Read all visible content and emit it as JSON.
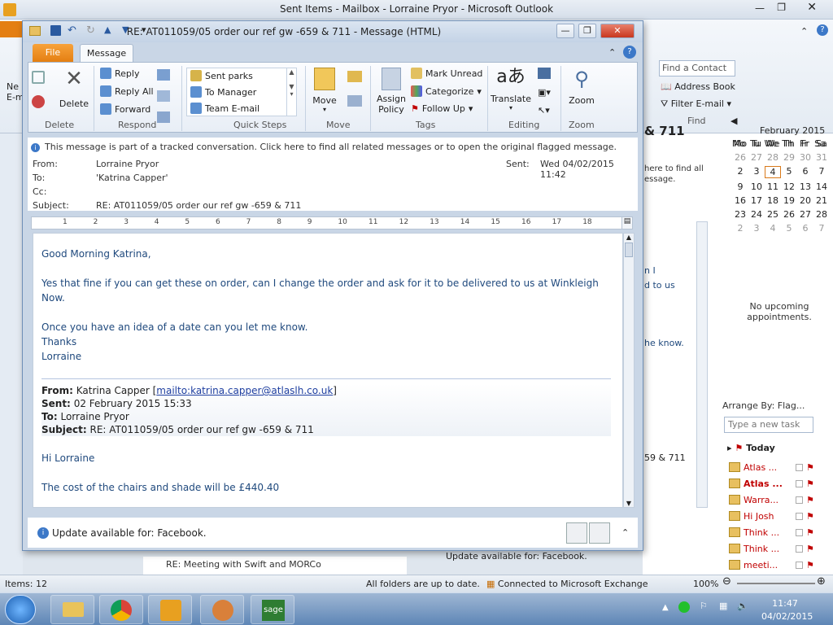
{
  "background": {
    "title": "Sent Items - Mailbox - Lorraine Pryor - Microsoft Outlook",
    "find_contact_placeholder": "Find a Contact",
    "address_book": "Address Book",
    "filter_email": "Filter E-mail",
    "find_group": "Find",
    "calendar": {
      "month": "February 2015",
      "weekdays": [
        "Mo",
        "Tu",
        "We",
        "Th",
        "Fr",
        "Sa"
      ],
      "rows": [
        [
          "26",
          "27",
          "28",
          "29",
          "30",
          "31"
        ],
        [
          "2",
          "3",
          "4",
          "5",
          "6",
          "7"
        ],
        [
          "9",
          "10",
          "11",
          "12",
          "13",
          "14"
        ],
        [
          "16",
          "17",
          "18",
          "19",
          "20",
          "21"
        ],
        [
          "23",
          "24",
          "25",
          "26",
          "27",
          "28"
        ],
        [
          "2",
          "3",
          "4",
          "5",
          "6",
          "7"
        ]
      ]
    },
    "no_appointments": "No upcoming appointments.",
    "arrange_by": "Arrange By: Flag...",
    "new_task_placeholder": "Type a new task",
    "today": "Today",
    "tasks": [
      "Atlas ...",
      "Atlas ...",
      "Warra...",
      "Hi Josh",
      "Think ...",
      "Think ...",
      "meeti..."
    ],
    "reading_snippets": [
      "& 711",
      "here to find all",
      "essage.",
      "n I",
      "d to us",
      "he know.",
      "59 & 711"
    ],
    "list_item_subject": "RE: Meeting with Swift and MORCo",
    "reading_update": "Update available for: Facebook.",
    "status": {
      "items": "Items: 12",
      "folders": "All folders are up to date.",
      "exchange": "Connected to Microsoft Exchange",
      "zoom": "100%"
    },
    "clock": {
      "time": "11:47",
      "date": "04/02/2015"
    },
    "left_labels": [
      "Ne",
      "E-m"
    ]
  },
  "window": {
    "title": "RE: AT011059/05 order our ref  gw -659 & 711  -  Message (HTML)",
    "tabs": {
      "file": "File",
      "message": "Message"
    },
    "ribbon": {
      "delete_label": "Delete",
      "reply": "Reply",
      "reply_all": "Reply All",
      "forward": "Forward",
      "quick_steps": [
        "Sent parks",
        "To Manager",
        "Team E-mail"
      ],
      "move": "Move",
      "assign_policy": "Assign Policy",
      "mark_unread": "Mark Unread",
      "categorize": "Categorize",
      "follow_up": "Follow Up",
      "translate": "Translate",
      "zoom": "Zoom",
      "groups": [
        "Delete",
        "Respond",
        "Quick Steps",
        "Move",
        "Tags",
        "Editing",
        "Zoom"
      ]
    },
    "info": "This message is part of a tracked conversation. Click here to find all related messages or to open the original flagged message.",
    "header": {
      "from_label": "From:",
      "from": "Lorraine Pryor",
      "to_label": "To:",
      "to": "'Katrina Capper'",
      "cc_label": "Cc:",
      "subject_label": "Subject:",
      "subject": "RE: AT011059/05 order our ref  gw -659 & 711",
      "sent_label": "Sent:",
      "sent": "Wed 04/02/2015 11:42"
    },
    "ruler_numbers": [
      "1",
      "2",
      "3",
      "4",
      "5",
      "6",
      "7",
      "8",
      "9",
      "10",
      "11",
      "12",
      "13",
      "14",
      "15",
      "16",
      "17",
      "18"
    ],
    "body": {
      "greeting": "Good Morning Katrina,",
      "para1": "Yes that fine if you can get these on order, can I change the order  and ask for it to be delivered  to us at Winkleigh Now.",
      "para2": "Once you have an idea of a date can you let me know.",
      "thanks": "Thanks",
      "signoff": "Lorraine",
      "quoted": {
        "from_label": "From:",
        "from": "Katrina Capper [",
        "from_link": "mailto:katrina.capper@atlaslh.co.uk",
        "from_close": "]",
        "sent_label": "Sent:",
        "sent": "02 February 2015 15:33",
        "to_label": "To:",
        "to": "Lorraine Pryor",
        "subject_label": "Subject:",
        "subject": "RE: AT011059/05 order our ref gw -659 & 711"
      },
      "hi": "Hi Lorraine",
      "cost": "The cost of the chairs and shade will be £440.40"
    },
    "update_bar": "Update available for: Facebook."
  }
}
